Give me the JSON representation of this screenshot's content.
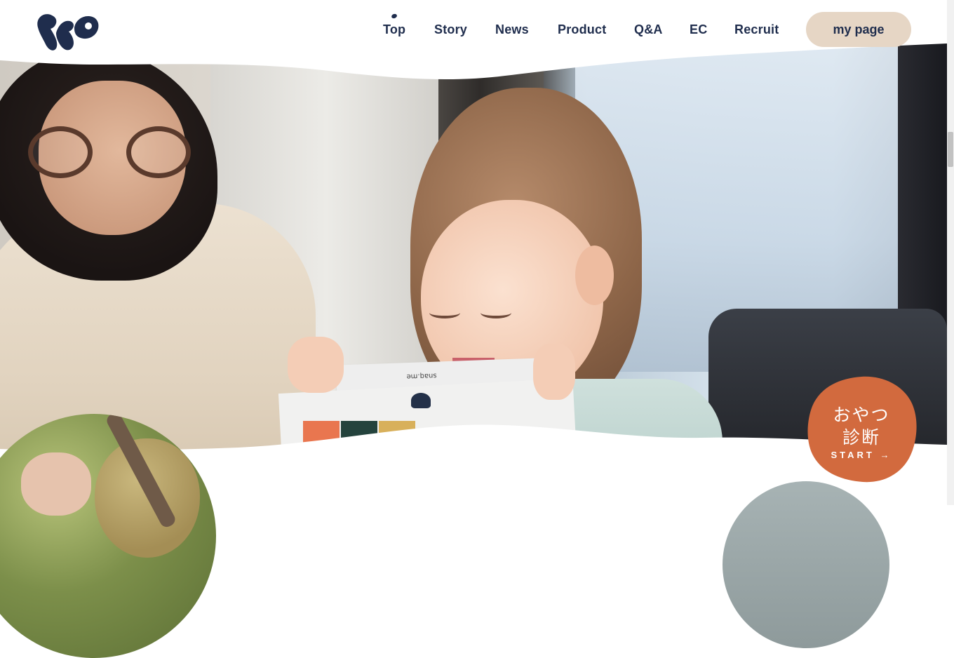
{
  "header": {
    "logo_name": "brand-logo",
    "nav": [
      {
        "label": "Top",
        "active": true
      },
      {
        "label": "Story"
      },
      {
        "label": "News"
      },
      {
        "label": "Product"
      },
      {
        "label": "Q&A"
      },
      {
        "label": "EC"
      },
      {
        "label": "Recruit"
      }
    ],
    "mypage_label": "my page"
  },
  "hero": {
    "box_label": "snaq.me"
  },
  "badge": {
    "line1": "おやつ",
    "line2": "診断",
    "start_label": "START",
    "start_arrow": "→",
    "color": "#d26a3e"
  },
  "colors": {
    "navy": "#1f2d4d",
    "mypage_bg": "#e6d6c5"
  }
}
